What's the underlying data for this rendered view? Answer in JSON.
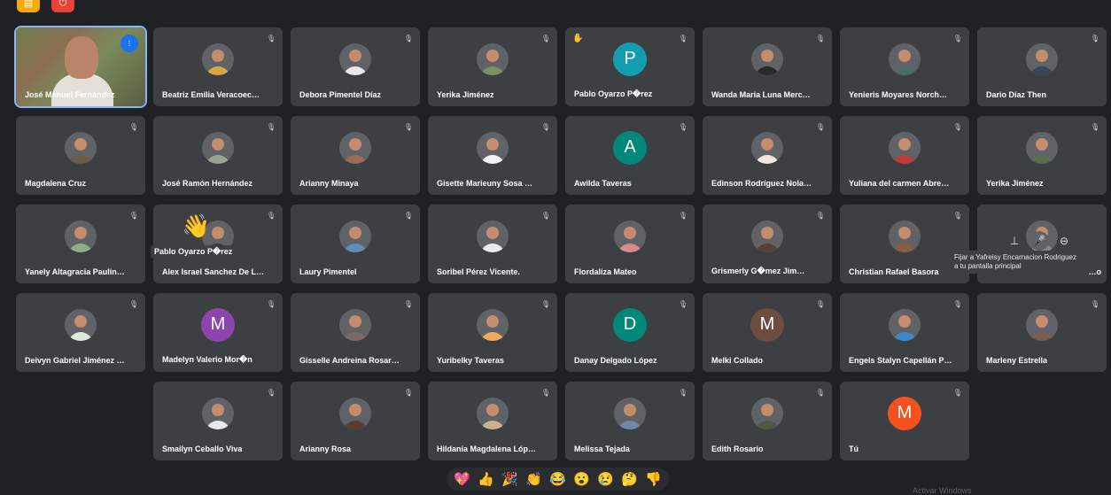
{
  "top_buttons": [
    {
      "name": "captions-button",
      "glyph": "▤",
      "bg": "#f9ab00"
    },
    {
      "name": "leave-call-button",
      "glyph": "⏻",
      "bg": "#ea4335"
    }
  ],
  "participants": [
    {
      "name": "José Manuel Fernández",
      "type": "video",
      "speaking": true
    },
    {
      "name": "Beatriz Emilia Veracoec…",
      "type": "photo",
      "color": "#d9a441"
    },
    {
      "name": "Debora Pimentel Díaz",
      "type": "photo",
      "color": "#e8e8e8"
    },
    {
      "name": "Yerika Jiménez",
      "type": "photo",
      "color": "#7a8f62"
    },
    {
      "name": "Pablo Oyarzo P�rez",
      "type": "letter",
      "letter": "P",
      "color": "#129eaf",
      "hand": true
    },
    {
      "name": "Wanda Maria Luna Merc…",
      "type": "photo",
      "color": "#2a2a2a"
    },
    {
      "name": "Yenieris Moyares Norch…",
      "type": "photo",
      "color": "#4b6b6a"
    },
    {
      "name": "Dario Díaz Then",
      "type": "photo",
      "color": "#3b4456"
    },
    {
      "name": "Magdalena Cruz",
      "type": "photo",
      "color": "#6d5b4b"
    },
    {
      "name": "José Ramón Hernández",
      "type": "photo",
      "color": "#9aa58f"
    },
    {
      "name": "Arianny Minaya",
      "type": "photo",
      "color": "#9a6b57"
    },
    {
      "name": "Gisette Marieuny Sosa …",
      "type": "photo",
      "color": "#f2f2f2"
    },
    {
      "name": "Awilda Taveras",
      "type": "letter",
      "letter": "A",
      "color": "#00897b"
    },
    {
      "name": "Edinson Rodríguez Nola…",
      "type": "photo",
      "color": "#f3e5d8"
    },
    {
      "name": "Yuliana del carmen Abre…",
      "type": "photo",
      "color": "#c23b3b"
    },
    {
      "name": "Yerika Jiménez",
      "type": "photo",
      "color": "#56704a"
    },
    {
      "name": "Yanely Altagracia Paulin…",
      "type": "photo",
      "color": "#8fae88"
    },
    {
      "name": "Alex Israel Sanchez De L…",
      "type": "photo",
      "color": "#3a3a3a"
    },
    {
      "name": "Laury Pimentel",
      "type": "photo",
      "color": "#5c8fb3"
    },
    {
      "name": "Soribel Pérez Vicente.",
      "type": "photo",
      "color": "#e9e9ee"
    },
    {
      "name": "Flordaliza Mateo",
      "type": "photo",
      "color": "#d98b8b"
    },
    {
      "name": "Grismerly G�mez Jim…",
      "type": "photo",
      "color": "#5a3f33"
    },
    {
      "name": "Christian Rafael Basora",
      "type": "photo",
      "color": "#8a5b3d"
    },
    {
      "name": "Yafreisy Encarnacion Ro…",
      "type": "photo",
      "color": "#888888",
      "hovered": true
    },
    {
      "name": "Deivyn Gabriel Jiménez …",
      "type": "photo",
      "color": "#dfe6dc"
    },
    {
      "name": "Madelyn Valerio Mor�n",
      "type": "letter",
      "letter": "M",
      "color": "#8e44ad"
    },
    {
      "name": "Gisselle Andreina Rosar…",
      "type": "photo",
      "color": "#7c6b5e"
    },
    {
      "name": "Yuribelky Taveras",
      "type": "photo",
      "color": "#f0a85e"
    },
    {
      "name": "Danay Delgado López",
      "type": "letter",
      "letter": "D",
      "color": "#00897b"
    },
    {
      "name": "Melki Collado",
      "type": "letter",
      "letter": "M",
      "color": "#6d4c41"
    },
    {
      "name": "Engels Stalyn Capellán P…",
      "type": "photo",
      "color": "#3f87c9"
    },
    {
      "name": "Marleny Estrella",
      "type": "photo",
      "color": "#7a5d4e"
    },
    {
      "name": "Smailyn Ceballo Viva",
      "type": "photo",
      "color": "#e8e8e8",
      "col": 1
    },
    {
      "name": "Arianny Rosa",
      "type": "photo",
      "color": "#5a3b34",
      "col": 2
    },
    {
      "name": "Hildania Magdalena Lóp…",
      "type": "photo",
      "color": "#c7b48a",
      "col": 3
    },
    {
      "name": "Melissa Tejada",
      "type": "photo",
      "color": "#6f87a8",
      "col": 4
    },
    {
      "name": "Edith Rosario",
      "type": "photo",
      "color": "#4c5a44",
      "col": 5
    },
    {
      "name": "Tú",
      "type": "letter",
      "letter": "M",
      "color": "#f4511e",
      "col": 6,
      "self": true
    }
  ],
  "hover_controls": {
    "pin_glyph": "⊥",
    "mute_glyph": "🎤",
    "remove_glyph": "⊖"
  },
  "tooltip": "Fijar a Yafreisy Encarnacion Rodriguez a tu pantalla principal",
  "hover_name_label": "Pablo Oyarzo P�rez",
  "reactions": [
    "💖",
    "👍",
    "🎉",
    "👏",
    "😂",
    "😮",
    "😢",
    "🤔",
    "👎"
  ],
  "watermark": "Activar Windows"
}
